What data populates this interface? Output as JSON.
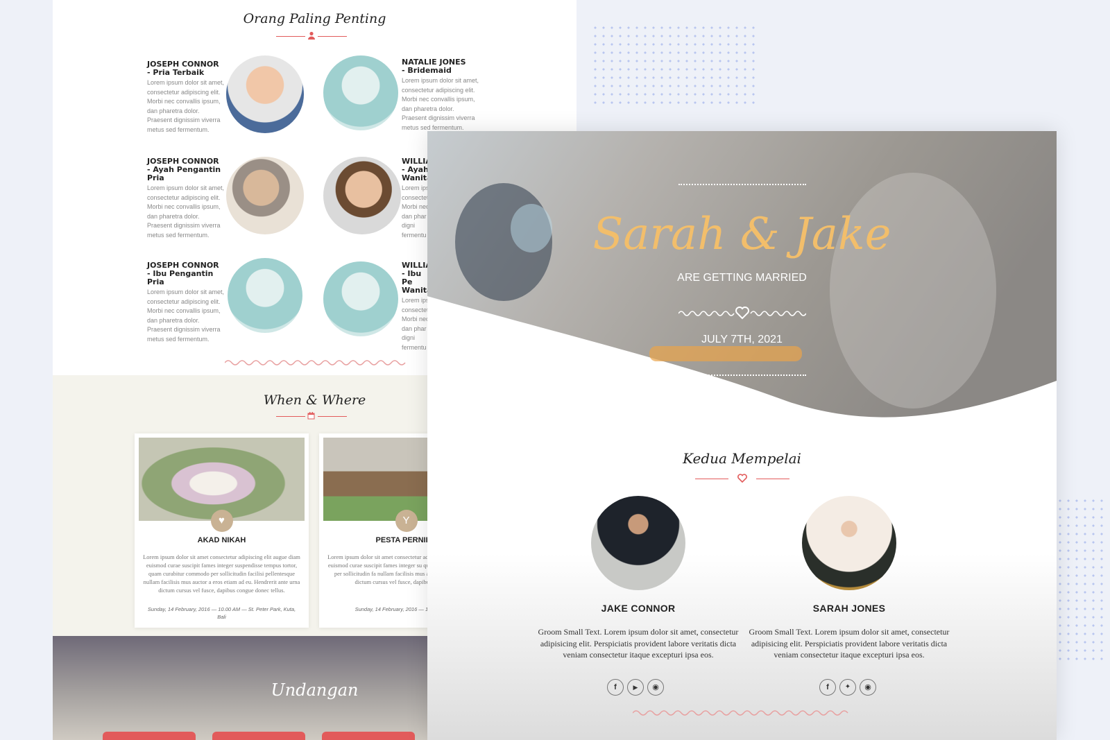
{
  "back_page": {
    "vip_section": {
      "title": "Orang Paling Penting",
      "people": [
        {
          "name": "JOSEPH CONNOR",
          "role": "- Pria Terbaik",
          "text": "Lorem ipsum dolor sit amet, consectetur adipiscing elit. Morbi nec convallis ipsum, dan pharetra dolor. Praesent dignissim viverra metus sed fermentum."
        },
        {
          "name": "NATALIE JONES",
          "role": "- Bridemaid",
          "text": "Lorem ipsum dolor sit amet, consectetur adipiscing elit. Morbi nec convallis ipsum, dan pharetra dolor. Praesent dignissim viverra metus sed fermentum."
        },
        {
          "name": "JOSEPH CONNOR",
          "role": "- Ayah Pengantin Pria",
          "text": "Lorem ipsum dolor sit amet, consectetur adipiscing elit. Morbi nec convallis ipsum, dan pharetra dolor. Praesent dignissim viverra metus sed fermentum."
        },
        {
          "name": "WILLIA",
          "role": "- Ayah Wanita",
          "text": "Lorem ips consectet Morbi nec dan phar digni fermentu"
        },
        {
          "name": "JOSEPH CONNOR",
          "role": "- Ibu Pengantin Pria",
          "text": "Lorem ipsum dolor sit amet, consectetur adipiscing elit. Morbi nec convallis ipsum, dan pharetra dolor. Praesent dignissim viverra metus sed fermentum."
        },
        {
          "name": "WILLIA",
          "role": "- Ibu Pe Wanita",
          "text": "Lorem ips consectet Morbi nec dan phar digni fermentu"
        }
      ]
    },
    "when_where": {
      "title": "When & Where",
      "cards": [
        {
          "title": "AKAD NIKAH",
          "text": "Lorem ipsum dolor sit amet consectetur adipiscing elit augue diam euismod curae suscipit fames integer suspendisse tempus tortor, quam curabitur commodo per sollicitudin facilisi pellentesque nullam facilisis mus auctor a eros etiam ad eu. Hendrerit ante urna dictum cursus vel fusce, dapibus congue donec tellus.",
          "meta": "Sunday, 14 February, 2016 — 10.00 AM — St. Peter Park, Kuta, Bali",
          "icon": "heart-icon"
        },
        {
          "title": "PESTA PERNIKA",
          "text": "Lorem ipsum dolor sit amet consectetur adipiscing elit augue diam euismod curae suscipit fames integer su quam curabitur commodo per sollicitudin fa nullam facilisis mus auctor a eros etiam ad dictum cursus vel fusce, dapibus congue do",
          "meta": "Sunday, 14 February, 2016 — 10.00 AM Bali",
          "icon": "cocktail-icon"
        }
      ]
    },
    "invitation": {
      "title": "Undangan"
    }
  },
  "front_page": {
    "hero": {
      "names": "Sarah & Jake",
      "subtitle": "ARE GETTING MARRIED",
      "date": "JULY 7TH, 2021"
    },
    "couple_section": {
      "title": "Kedua Mempelai",
      "people": [
        {
          "name": "JAKE CONNOR",
          "text": "Groom Small Text. Lorem ipsum dolor sit amet, consectetur adipisicing elit. Perspiciatis provident labore veritatis dicta veniam consectetur itaque excepturi ipsa eos.",
          "social": [
            "facebook-icon",
            "youtube-icon",
            "instagram-icon"
          ]
        },
        {
          "name": "SARAH JONES",
          "text": "Groom Small Text. Lorem ipsum dolor sit amet, consectetur adipisicing elit. Perspiciatis provident labore veritatis dicta veniam consectetur itaque excepturi ipsa eos.",
          "social": [
            "facebook-icon",
            "twitter-icon",
            "instagram-icon"
          ]
        }
      ]
    }
  },
  "colors": {
    "accent": "#e25b5b",
    "gold": "#f2be6b",
    "tan": "#c9b294"
  }
}
